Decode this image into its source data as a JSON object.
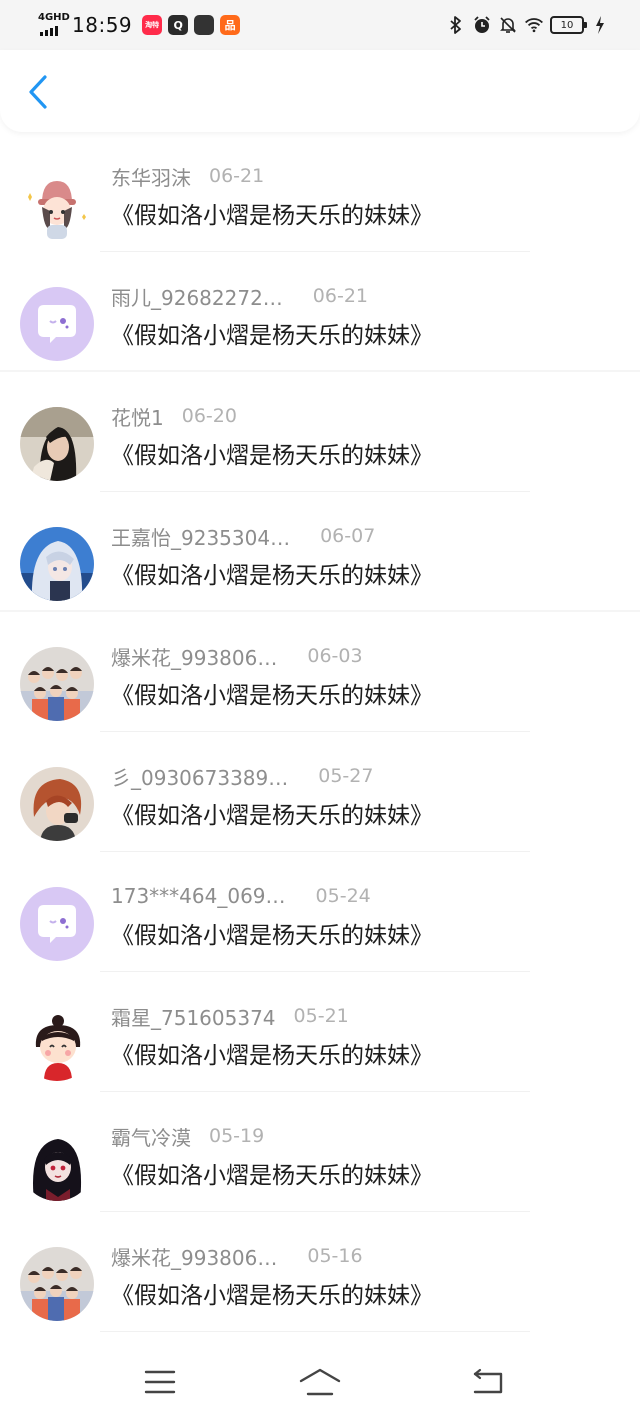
{
  "status_bar": {
    "network": "4GHD",
    "time": "18:59",
    "battery": "10",
    "app_icons": [
      {
        "name": "shopping-app-icon",
        "color": "#ff2b4a",
        "glyph": "淘特"
      },
      {
        "name": "q-app-icon",
        "color": "#2b2b2b",
        "glyph": "Q"
      },
      {
        "name": "square-app-icon",
        "color": "#333333",
        "glyph": ""
      },
      {
        "name": "orange-app-icon",
        "color": "#ff6a1a",
        "glyph": "品"
      }
    ]
  },
  "colors": {
    "accent": "#2196f3",
    "username": "#8d8d8d",
    "date": "#b2b2b2",
    "message": "#1d1d1d"
  },
  "comments": [
    {
      "username": "东华羽沫",
      "date": "06-21",
      "message": "《假如洛小熠是杨天乐的妹妹》",
      "avatar": "cartoon-girl-avatar"
    },
    {
      "username": "雨儿_92682272…",
      "date": "06-21",
      "message": "《假如洛小熠是杨天乐的妹妹》",
      "avatar": "default-chat-avatar"
    },
    {
      "username": "花悦1",
      "date": "06-20",
      "message": "《假如洛小熠是杨天乐的妹妹》",
      "avatar": "photo-girl-avatar"
    },
    {
      "username": "王嘉怡_9235304…",
      "date": "06-07",
      "message": "《假如洛小熠是杨天乐的妹妹》",
      "avatar": "anime-silver-hair-avatar"
    },
    {
      "username": "爆米花_993806…",
      "date": "06-03",
      "message": "《假如洛小熠是杨天乐的妹妹》",
      "avatar": "group-photo-avatar"
    },
    {
      "username": "彡_0930673389…",
      "date": "05-27",
      "message": "《假如洛小熠是杨天乐的妹妹》",
      "avatar": "anime-red-hair-avatar"
    },
    {
      "username": "173***464_069…",
      "date": "05-24",
      "message": "《假如洛小熠是杨天乐的妹妹》",
      "avatar": "default-chat-avatar"
    },
    {
      "username": "霜星_751605374",
      "date": "05-21",
      "message": "《假如洛小熠是杨天乐的妹妹》",
      "avatar": "cartoon-red-girl-avatar"
    },
    {
      "username": "霸气冷漠",
      "date": "05-19",
      "message": "《假如洛小熠是杨天乐的妹妹》",
      "avatar": "anime-dark-girl-avatar"
    },
    {
      "username": "爆米花_993806…",
      "date": "05-16",
      "message": "《假如洛小熠是杨天乐的妹妹》",
      "avatar": "group-photo-avatar"
    }
  ]
}
